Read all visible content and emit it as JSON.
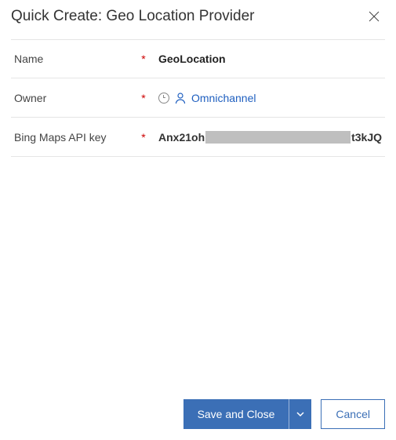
{
  "header": {
    "title": "Quick Create: Geo Location Provider"
  },
  "form": {
    "name": {
      "label": "Name",
      "value": "GeoLocation"
    },
    "owner": {
      "label": "Owner",
      "value": "Omnichannel"
    },
    "apikey": {
      "label": "Bing Maps API key",
      "prefix": "Anx21oh",
      "suffix": "t3kJQ"
    }
  },
  "footer": {
    "save": "Save and Close",
    "cancel": "Cancel"
  }
}
